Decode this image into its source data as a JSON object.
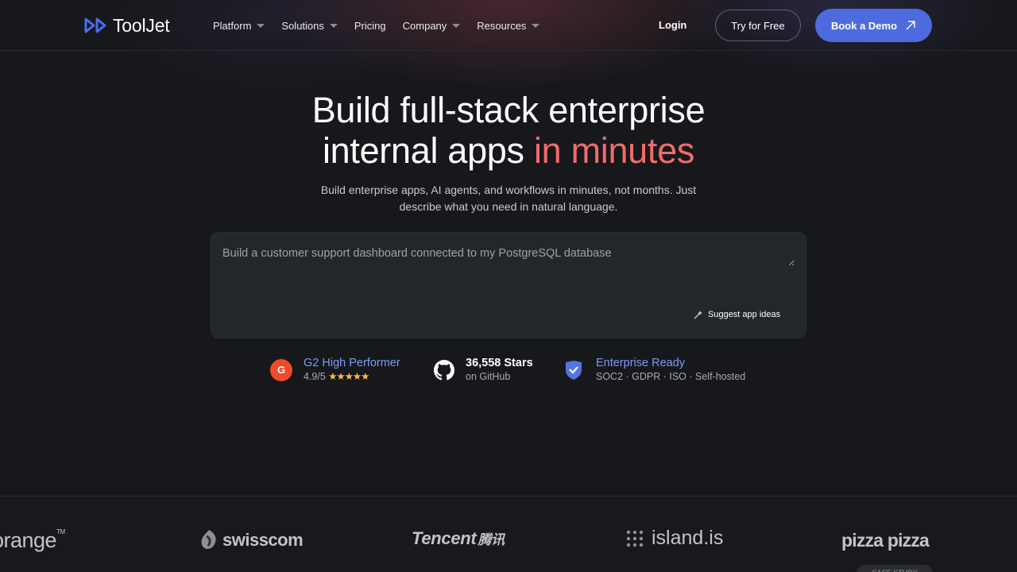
{
  "nav": {
    "logo_text": "ToolJet",
    "items": [
      {
        "label": "Platform",
        "dropdown": true
      },
      {
        "label": "Solutions",
        "dropdown": true
      },
      {
        "label": "Pricing",
        "dropdown": false
      },
      {
        "label": "Company",
        "dropdown": true
      },
      {
        "label": "Resources",
        "dropdown": true
      }
    ],
    "login_label": "Login",
    "try_label": "Try for Free",
    "demo_label": "Book a Demo"
  },
  "hero": {
    "title_line1": "Build full-stack enterprise",
    "title_line2_plain": "internal apps ",
    "title_line2_accent": "in minutes",
    "subtitle": "Build enterprise apps, AI agents, and workflows in minutes, not months. Just describe what you need in natural language.",
    "prompt_placeholder": "Build a customer support dashboard connected to my PostgreSQL database",
    "suggest_label": "Suggest app ideas"
  },
  "badges": {
    "g2": {
      "icon_letter": "G",
      "title": "G2 High Performer",
      "rating": "4.9/5",
      "stars": "★★★★★"
    },
    "github": {
      "title": "36,558 Stars",
      "subtitle": "on GitHub"
    },
    "enterprise": {
      "title": "Enterprise Ready",
      "subtitle": "SOC2 · GDPR · ISO · Self-hosted"
    }
  },
  "logos": {
    "orange": "orange",
    "orange_tm": "TM",
    "swisscom": "swisscom",
    "tencent": "Tencent",
    "tencent_cn": "腾讯",
    "island": "island.is",
    "pizza": "pizza pizza",
    "case_study": "CASE STUDY"
  },
  "colors": {
    "background": "#17181c",
    "accent_red": "#f06c6c",
    "brand_blue": "#4d6bdf",
    "link_blue": "#7e9cf2"
  }
}
